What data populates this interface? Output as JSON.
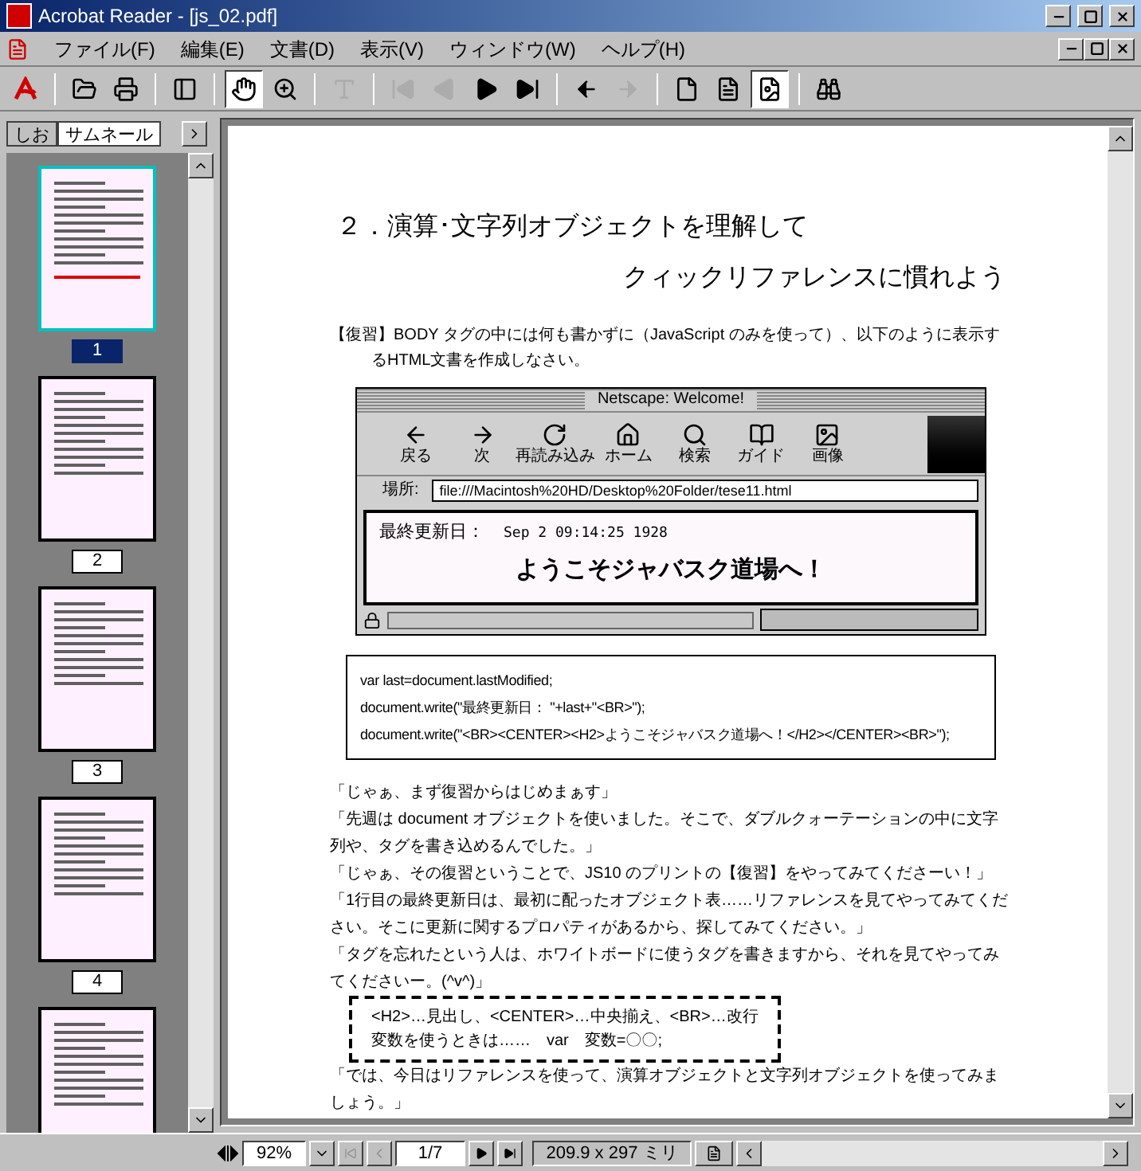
{
  "window": {
    "title": "Acrobat Reader - [js_02.pdf]"
  },
  "menu": [
    "ファイル(F)",
    "編集(E)",
    "文書(D)",
    "表示(V)",
    "ウィンドウ(W)",
    "ヘルプ(H)"
  ],
  "toolbar": [
    {
      "kind": "logo"
    },
    {
      "kind": "open",
      "selected": false,
      "disabled": false
    },
    {
      "kind": "print",
      "selected": false,
      "disabled": false
    },
    {
      "kind": "panel",
      "selected": false,
      "disabled": false
    },
    {
      "kind": "hand",
      "selected": true,
      "disabled": false
    },
    {
      "kind": "zoom",
      "selected": false,
      "disabled": false
    },
    {
      "kind": "text",
      "selected": false,
      "disabled": true
    },
    {
      "kind": "first",
      "selected": false,
      "disabled": true
    },
    {
      "kind": "prev",
      "selected": false,
      "disabled": true
    },
    {
      "kind": "next",
      "selected": false,
      "disabled": false
    },
    {
      "kind": "last",
      "selected": false,
      "disabled": false
    },
    {
      "kind": "back",
      "selected": false,
      "disabled": false
    },
    {
      "kind": "forward",
      "selected": false,
      "disabled": true
    },
    {
      "kind": "actual",
      "selected": false,
      "disabled": false
    },
    {
      "kind": "fitpage",
      "selected": false,
      "disabled": false
    },
    {
      "kind": "fitwidth",
      "selected": true,
      "disabled": false
    },
    {
      "kind": "find",
      "selected": false,
      "disabled": false
    }
  ],
  "panel_tabs": [
    {
      "label": "しお",
      "selected": false
    },
    {
      "label": "サムネール",
      "selected": true
    }
  ],
  "thumbnails": [
    {
      "label": "1",
      "selected": true
    },
    {
      "label": "2",
      "selected": false
    },
    {
      "label": "3",
      "selected": false
    },
    {
      "label": "4",
      "selected": false
    },
    {
      "selected": false
    }
  ],
  "document": {
    "heading_line_1": "２．演算･文字列オブジェクトを理解して",
    "heading_line_2": "クィックリファレンスに慣れよう",
    "task": "【復習】BODY タグの中には何も書かずに（JavaScript のみを使って）、以下のように表示するHTML文書を作成しなさい。",
    "browser": {
      "title": "Netscape: Welcome!",
      "buttons": [
        "戻る",
        "次",
        "再読み込み",
        "ホーム",
        "検索",
        "ガイド",
        "画像"
      ],
      "location_label": "場所:",
      "url": "file:///Macintosh%20HD/Desktop%20Folder/tese11.html",
      "last_modified_label": "最終更新日：",
      "last_modified": "Sep 2 09:14:25 1928",
      "welcome": "ようこそジャバスク道場へ！"
    },
    "code": [
      "var last=document.lastModified;",
      "document.write(\"最終更新日： \"+last+\"<BR>\");",
      "document.write(\"<BR><CENTER><H2>ようこそジャバスク道場へ！</H2></CENTER><BR>\");"
    ],
    "dialogue": [
      "「じゃぁ、まず復習からはじめまぁす」",
      "「先週は document オブジェクトを使いました。そこで、ダブルクォーテーションの中に文字列や、タグを書き込めるんでした。」",
      "「じゃぁ、その復習ということで、JS10 のプリントの【復習】をやってみてくださーい！」",
      "「1行目の最終更新日は、最初に配ったオブジェクト表……リファレンスを見てやってみてください。そこに更新に関するプロパティがあるから、探してみてください。」",
      "「タグを忘れたという人は、ホワイトボードに使うタグを書きますから、それを見てやってみてくださいー。(^v^)」"
    ],
    "note": [
      "<H2>…見出し、<CENTER>…中央揃え、<BR>…改行",
      "変数を使うときは……　var　変数=〇〇;"
    ],
    "dialogue_2": [
      "「では、今日はリファレンスを使って、演算オブジェクトと文字列オブジェクトを使ってみましょう。」"
    ]
  },
  "status_bar": {
    "zoom": "92%",
    "page": "1/7",
    "page_size": "209.9 x 297 ミリ"
  }
}
